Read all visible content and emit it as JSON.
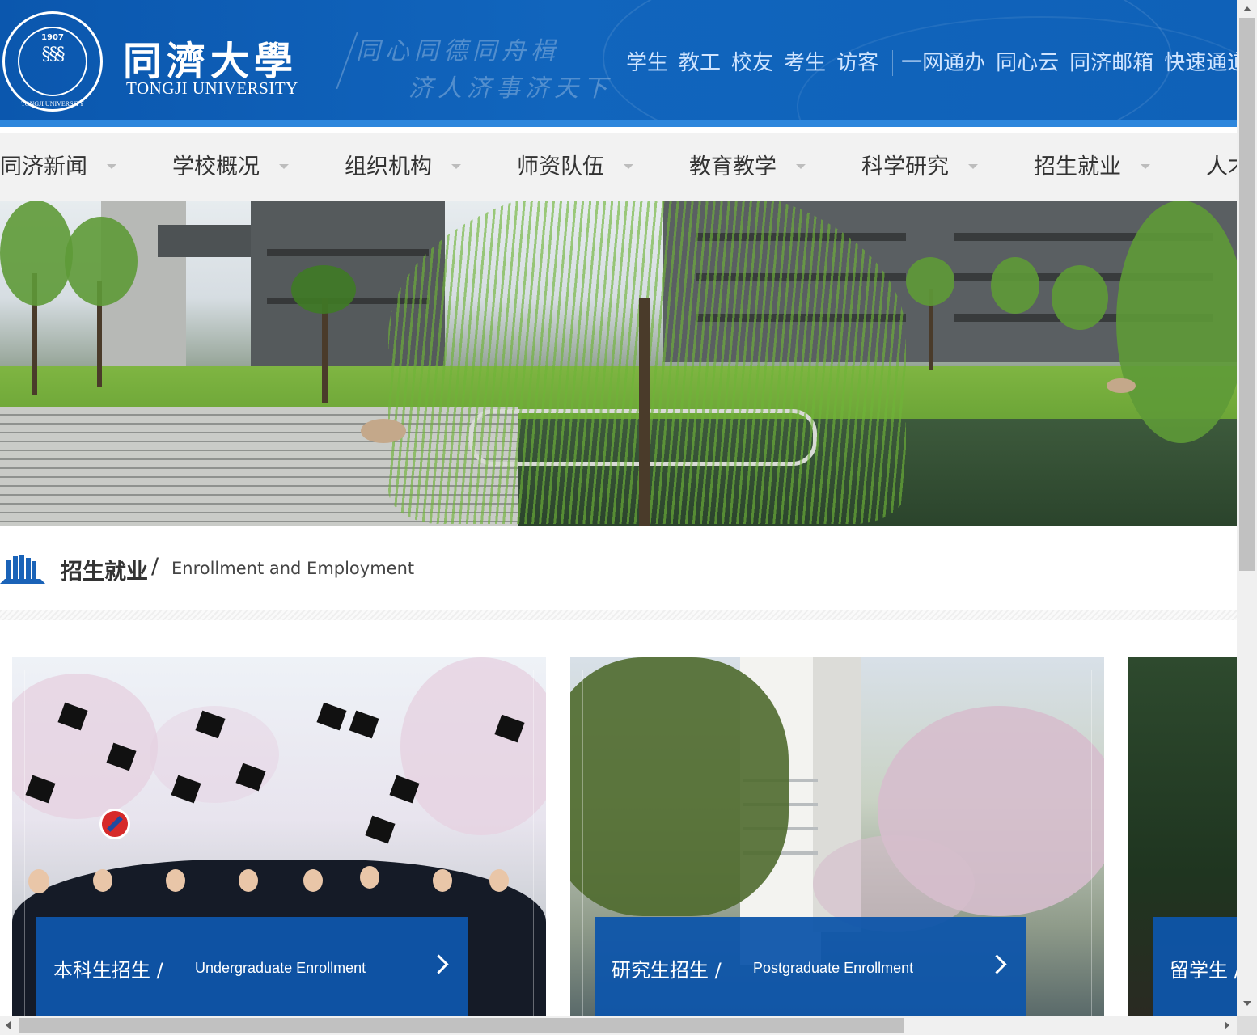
{
  "header": {
    "logo_year": "1907",
    "logo_seal_text": "TONGJI UNIVERSITY",
    "logo_cn": "同濟大學",
    "logo_en": "TONGJI UNIVERSITY",
    "slogan_line1": "同心同德同舟楫",
    "slogan_line2": "济人济事济天下",
    "quick_links": [
      "学生",
      "教工",
      "校友",
      "考生",
      "访客"
    ],
    "service_links": [
      "一网通办",
      "同心云",
      "同济邮箱",
      "快速通道"
    ],
    "colors": {
      "header_bg": "#0f5fb6",
      "header_stripe": "#2d86dc",
      "link_text": "#cfe4ff"
    }
  },
  "nav": {
    "items": [
      {
        "label": "同济新闻"
      },
      {
        "label": "学校概况"
      },
      {
        "label": "组织机构"
      },
      {
        "label": "师资队伍"
      },
      {
        "label": "教育教学"
      },
      {
        "label": "科学研究"
      },
      {
        "label": "招生就业"
      },
      {
        "label": "人才"
      }
    ]
  },
  "banner": {
    "icon": "campus-photo"
  },
  "section": {
    "icon": "books-icon",
    "title_cn": "招生就业",
    "separator": "/",
    "title_en": "Enrollment and Employment"
  },
  "cards": [
    {
      "title_cn": "本科生招生",
      "separator": "/",
      "title_en": "Undergraduate Enrollment",
      "icon": "chevron-right-icon"
    },
    {
      "title_cn": "研究生招生",
      "separator": "/",
      "title_en": "Postgraduate Enrollment",
      "icon": "chevron-right-icon"
    },
    {
      "title_cn": "留学生",
      "separator": "/",
      "title_en": "",
      "icon": "chevron-right-icon"
    }
  ],
  "colors": {
    "card_label_bg": "#0e55aa",
    "nav_bg": "#f2f2f2",
    "accent": "#1165bd"
  }
}
